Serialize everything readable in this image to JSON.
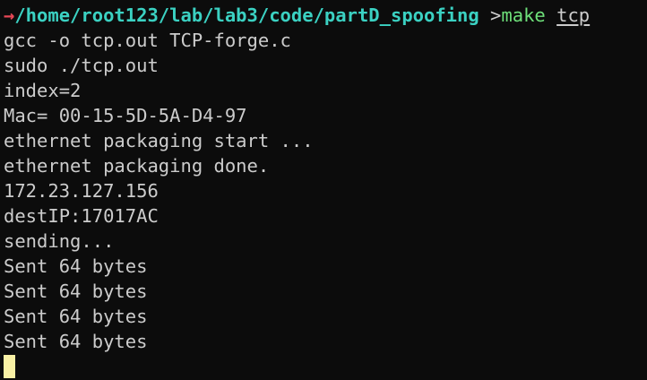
{
  "prompt": {
    "arrow": "→",
    "path": "/home/root123/lab/lab3/code/partD_spoofing",
    "separator": " >",
    "command": "make",
    "argument": "tcp"
  },
  "output": [
    "gcc -o tcp.out TCP-forge.c",
    "sudo ./tcp.out",
    "index=2",
    "Mac= 00-15-5D-5A-D4-97",
    "ethernet packaging start ...",
    "ethernet packaging done.",
    "172.23.127.156",
    "destIP:17017AC",
    "sending...",
    "Sent 64 bytes",
    "Sent 64 bytes",
    "Sent 64 bytes",
    "Sent 64 bytes"
  ],
  "colors": {
    "background": "#0c0c0c",
    "foreground": "#cccccc",
    "arrow": "#e74856",
    "path": "#3bd1c2",
    "command": "#6ee07a",
    "cursor": "#f9f1a5"
  }
}
